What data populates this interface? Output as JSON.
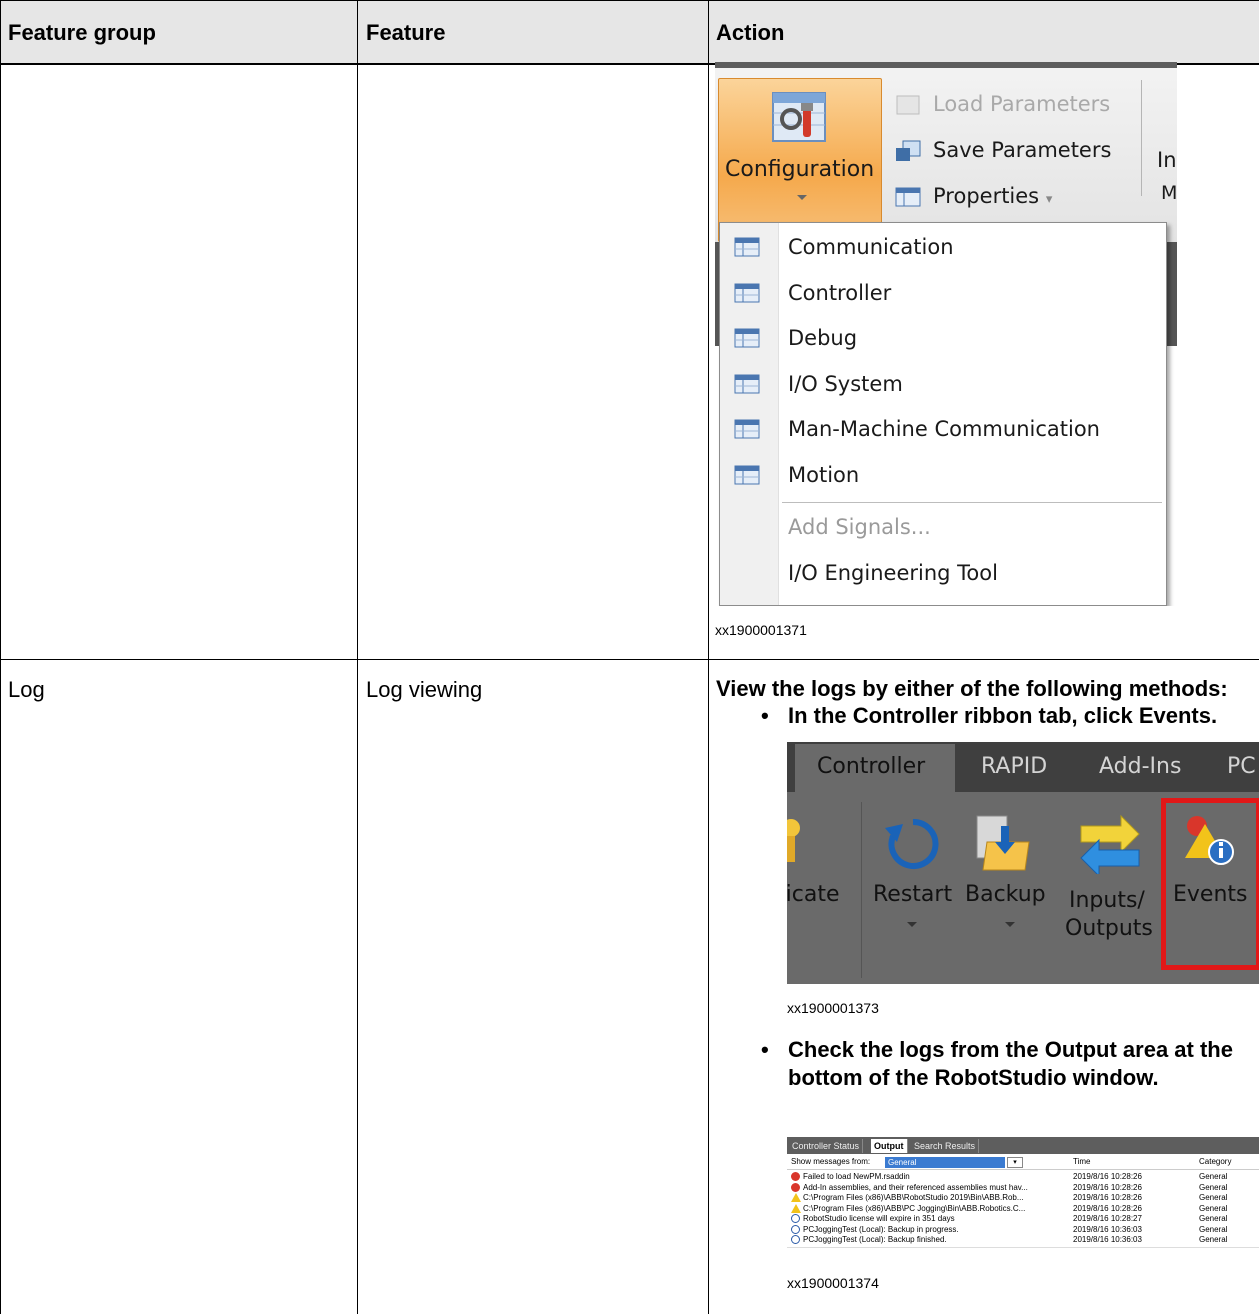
{
  "table": {
    "headers": [
      "Feature group",
      "Feature",
      "Action"
    ]
  },
  "row1": {
    "ribbon": {
      "configuration_label": "Configuration",
      "load_parameters": "Load Parameters",
      "save_parameters": "Save Parameters",
      "properties": "Properties",
      "properties_arrow": "▾",
      "clipped_1": "In",
      "clipped_2": "M"
    },
    "menu_items": [
      "Communication",
      "Controller",
      "Debug",
      "I/O System",
      "Man-Machine Communication",
      "Motion"
    ],
    "menu_extra": {
      "add_signals": "Add Signals...",
      "io_engineering_tool": "I/O Engineering Tool"
    },
    "caption": "xx1900001371"
  },
  "row2": {
    "feature_group": "Log",
    "feature": "Log viewing",
    "intro": "View the logs by either of the following methods:",
    "bullet_glyph": "•",
    "bullet1": {
      "pre": "In the ",
      "bold1": "Controller",
      "mid": " ribbon tab, click ",
      "bold2": "Events",
      "post": "."
    },
    "bullet2": {
      "pre": "Check the logs from the ",
      "bold1": "Output",
      "post1": " area at the",
      "line2": "bottom of the RobotStudio window."
    },
    "controller_ribbon": {
      "tabs": [
        "Controller",
        "RAPID",
        "Add-Ins",
        "PC"
      ],
      "buttons": [
        "ticate",
        "Restart",
        "Backup",
        "Inputs/",
        "Outputs",
        "Events"
      ]
    },
    "caption1": "xx1900001373",
    "output_window": {
      "tabs": [
        "Controller Status",
        "Output",
        "Search Results"
      ],
      "filter_label": "Show messages from:",
      "filter_value": "General",
      "dropdown_glyph": "▾",
      "col_time": "Time",
      "col_category": "Category",
      "rows": [
        {
          "icon": "error",
          "message": "Failed to load NewPM.rsaddin",
          "time": "2019/8/16 10:28:26",
          "category": "General"
        },
        {
          "icon": "error",
          "message": "Add-In assemblies, and their referenced assemblies must hav...",
          "time": "2019/8/16 10:28:26",
          "category": "General"
        },
        {
          "icon": "warning",
          "message": "C:\\Program Files (x86)\\ABB\\RobotStudio 2019\\Bin\\ABB.Rob...",
          "time": "2019/8/16 10:28:26",
          "category": "General"
        },
        {
          "icon": "warning",
          "message": "C:\\Program Files (x86)\\ABB\\PC Jogging\\Bin\\ABB.Robotics.C...",
          "time": "2019/8/16 10:28:26",
          "category": "General"
        },
        {
          "icon": "info",
          "message": "RobotStudio license will expire in 351 days",
          "time": "2019/8/16 10:28:27",
          "category": "General"
        },
        {
          "icon": "info",
          "message": "PCJoggingTest (Local): Backup in progress.",
          "time": "2019/8/16 10:36:03",
          "category": "General"
        },
        {
          "icon": "info",
          "message": "PCJoggingTest (Local): Backup finished.",
          "time": "2019/8/16 10:36:03",
          "category": "General"
        }
      ]
    },
    "caption2": "xx1900001374"
  }
}
